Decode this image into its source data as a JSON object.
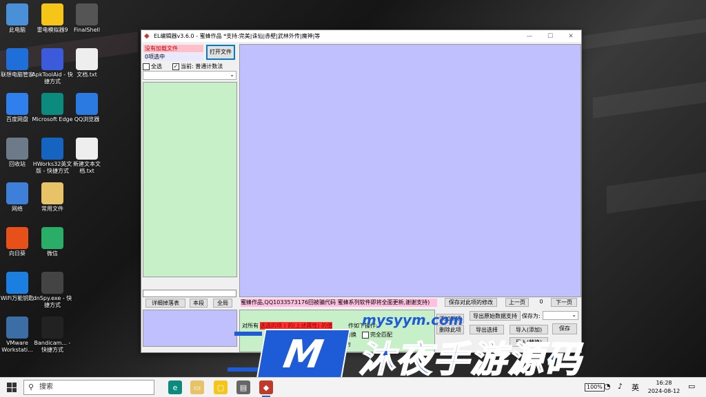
{
  "desktop": {
    "icons": [
      {
        "label": "此电脑",
        "color": "#4a90d9"
      },
      {
        "label": "雷电模拟器9",
        "color": "#f5c518"
      },
      {
        "label": "FinalShell",
        "color": "#555555"
      },
      {
        "label": "联想电脑管家",
        "color": "#1e6fd9"
      },
      {
        "label": "ApkToolAid - 快捷方式",
        "color": "#3b5bdb"
      },
      {
        "label": "文档.txt",
        "color": "#eeeeee"
      },
      {
        "label": "百度网盘",
        "color": "#2f80ed"
      },
      {
        "label": "Microsoft Edge",
        "color": "#0c8a7e"
      },
      {
        "label": "QQ浏览器",
        "color": "#2a7ae2"
      },
      {
        "label": "回收站",
        "color": "#6c7a89"
      },
      {
        "label": "HWorks32英文版 - 快捷方式",
        "color": "#1565c0"
      },
      {
        "label": "新建文本文档.txt",
        "color": "#eeeeee"
      },
      {
        "label": "网络",
        "color": "#3d7fd9"
      },
      {
        "label": "常用文件",
        "color": "#e8c266"
      },
      {
        "label": "向日葵",
        "color": "#e8501a"
      },
      {
        "label": "微信",
        "color": "#2aae67"
      },
      {
        "label": "WiFi万能钥匙",
        "color": "#1a7fe0"
      },
      {
        "label": "dnSpy.exe - 快捷方式",
        "color": "#444444"
      },
      {
        "label": "VMware Workstati...",
        "color": "#3a6ea5"
      },
      {
        "label": "Bandicam... - 快捷方式",
        "color": "#222222"
      }
    ]
  },
  "window": {
    "title": "EL编辑器v3.6.0 - 蜜蜂作品 *支持:完美|诛仙|赤壁|武林外传|魔神|等",
    "controls": {
      "min": "—",
      "max": "☐",
      "close": "✕"
    },
    "status_file": "没有加载文件",
    "status_select": "0项选中",
    "open_btn": "打开文件",
    "chk_all": "全选",
    "chk_current": "当前: 普通计数法",
    "tab_btns": [
      "详细掉落表",
      "本段",
      "全局"
    ],
    "credit": "蜜蜂作品,QQ1033573176回被骗代码 蜜蜂系列软件即将全面更新,谢谢支持)",
    "save_sel_btn": "保存对此项的修改",
    "prev_btn": "上一页",
    "page_num": "0",
    "next_btn": "下一页",
    "lower": {
      "op_label": "对所有",
      "op_highlight": "选选的项 ) 的(上述属性) 的值",
      "op_suffix": "作如下操作:",
      "replace": "替换",
      "full_match": "完全匹配",
      "as_label": "为",
      "add_btn": "添加新项",
      "del_btn": "删除此项",
      "export_btn": "导出原始数据支持",
      "save_as_label": "保存为:",
      "export_sel_btn": "导出选择",
      "import_add_btn": "导入(添加)",
      "save_btn": "保存",
      "import_replace_btn": "导入(替换)"
    }
  },
  "watermark": {
    "url": "mysyym.com",
    "big": "沐夜手游源码",
    "m": "M"
  },
  "taskbar": {
    "search_placeholder": "搜索",
    "time": "16:28",
    "date": "2024-08-12",
    "battery": "100%"
  }
}
